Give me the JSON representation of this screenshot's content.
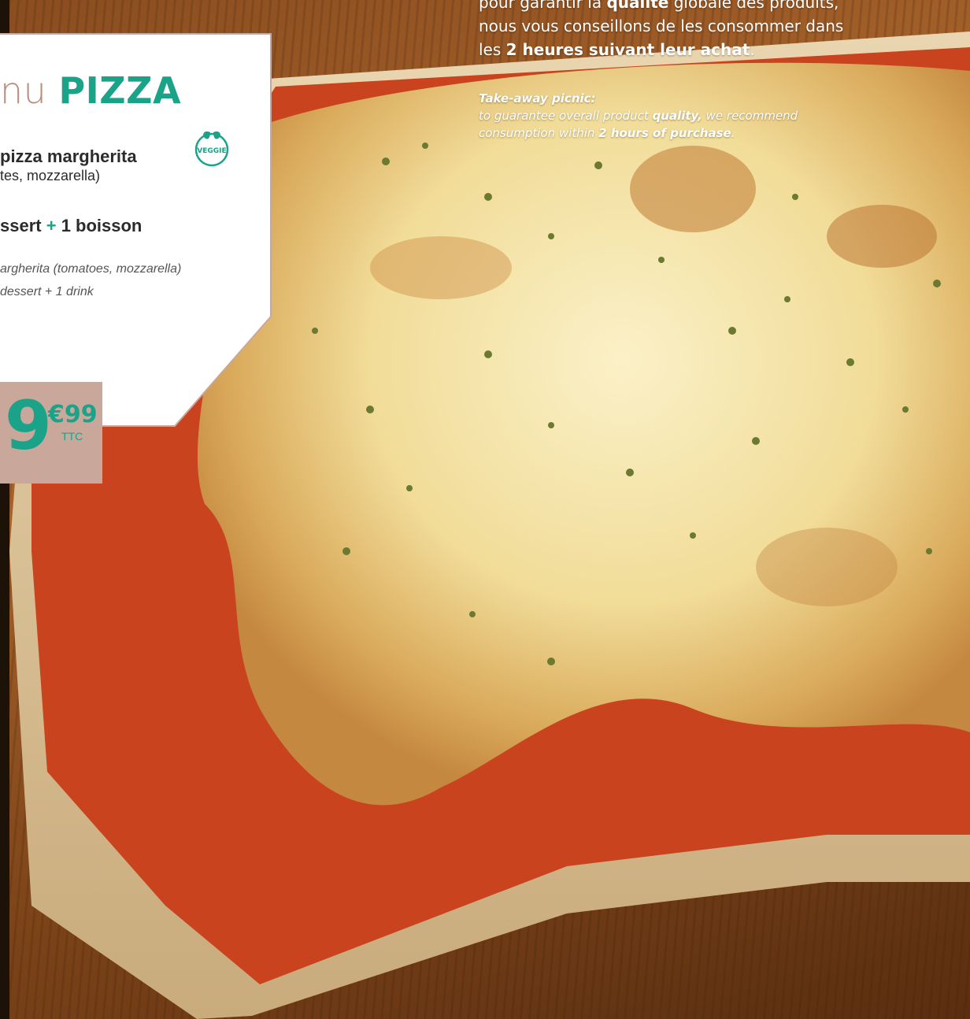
{
  "menu": {
    "title_light": "nu ",
    "title_bold": "PIZZA",
    "item_line1": "pizza margherita",
    "item_line2": "tes, mozzarella)",
    "item_line3_a": "ssert ",
    "item_line3_plus": "+",
    "item_line3_b": " 1 boisson",
    "en_line1": "argherita (tomatoes, mozzarella)",
    "en_line2": "dessert + 1 drink",
    "veggie_badge": "VEGGIE"
  },
  "price": {
    "euros": "9",
    "cents": "€99",
    "tax": "TTC"
  },
  "notice_fr": {
    "line1_a": "pour garantir la ",
    "line1_b": "qualité",
    "line1_c": " globale des produits,",
    "line2": "nous vous conseillons de les consommer dans",
    "line3_a": "les ",
    "line3_b": "2 heures suivant leur achat",
    "line3_c": "."
  },
  "notice_en": {
    "heading": "Take-away picnic:",
    "line1_a": "to guarantee overall product ",
    "line1_b": "quality,",
    "line1_c": " we recommend",
    "line2_a": "consumption within ",
    "line2_b": "2 hours of purchase",
    "line2_c": "."
  },
  "colors": {
    "accent": "#1aa389",
    "title_light": "#b98f7d",
    "price_box": "#c9a79a"
  }
}
